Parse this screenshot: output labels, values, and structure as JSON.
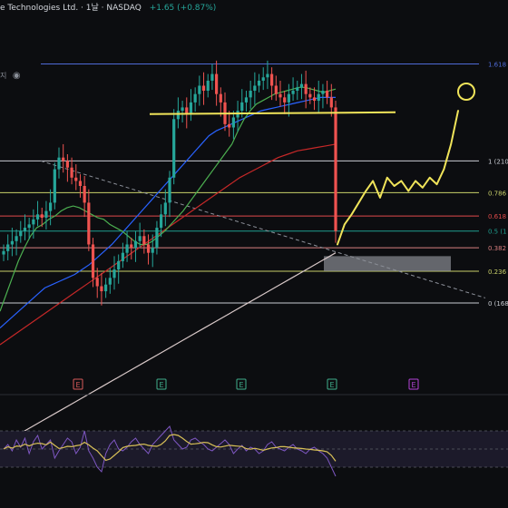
{
  "header": {
    "symbol_text": "e Technologies Ltd. · 1날 · NASDAQ",
    "change_text": "+1.65 (+0.87%)"
  },
  "indicator_label": "지",
  "chart_data": {
    "type": "line",
    "price_axis": {
      "min": 100,
      "max": 290
    },
    "bars_count": 79,
    "fib_levels": [
      {
        "label": "1.618",
        "value": 268,
        "color": "#4f6bd8"
      },
      {
        "label": "1 (210",
        "value": 210,
        "color": "#c9ccd2"
      },
      {
        "label": "0.786",
        "value": 191,
        "color": "#c9d06a"
      },
      {
        "label": "0.618",
        "value": 177,
        "color": "#e04a4a"
      },
      {
        "label": "0.5 (1",
        "value": 168,
        "color": "#1f9e8f"
      },
      {
        "label": "0.382",
        "value": 158,
        "color": "#d97f7f"
      },
      {
        "label": "0.236",
        "value": 144,
        "color": "#c9d06a"
      },
      {
        "label": "0 (168",
        "value": 125,
        "color": "#c9ccd2"
      }
    ],
    "candles_close": [
      156,
      160,
      162,
      165,
      168,
      170,
      172,
      175,
      178,
      176,
      180,
      185,
      205,
      212,
      210,
      206,
      200,
      198,
      195,
      185,
      160,
      140,
      135,
      132,
      136,
      140,
      145,
      150,
      155,
      160,
      158,
      162,
      165,
      160,
      155,
      158,
      170,
      178,
      185,
      200,
      235,
      240,
      242,
      238,
      245,
      250,
      255,
      252,
      258,
      262,
      250,
      245,
      232,
      230,
      236,
      240,
      245,
      248,
      252,
      255,
      258,
      260,
      262,
      255,
      250,
      248,
      245,
      250,
      252,
      254,
      256,
      250,
      248,
      246,
      250,
      252,
      248,
      242,
      168
    ],
    "ma_fast": [
      120,
      130,
      140,
      150,
      158,
      165,
      170,
      172,
      175,
      177,
      180,
      182,
      183,
      182,
      180,
      178,
      176,
      175,
      172,
      170,
      168,
      165,
      162,
      160,
      160,
      162,
      165,
      168,
      172,
      176,
      180,
      185,
      190,
      195,
      200,
      205,
      210,
      215,
      220,
      228,
      235,
      240,
      244,
      246,
      248,
      250,
      251,
      252,
      253,
      254,
      254,
      253,
      252,
      251,
      252,
      253
    ],
    "ma_mid": [
      110,
      114,
      118,
      122,
      126,
      130,
      134,
      136,
      138,
      140,
      142,
      145,
      148,
      152,
      156,
      160,
      165,
      170,
      175,
      180,
      185,
      190,
      195,
      200,
      205,
      210,
      215,
      220,
      225,
      228,
      230,
      232,
      234,
      236,
      238,
      240,
      241,
      242,
      243,
      244,
      245,
      246,
      247,
      248,
      248,
      248
    ],
    "ma_slow": [
      100,
      104,
      108,
      112,
      116,
      120,
      124,
      128,
      132,
      136,
      140,
      144,
      148,
      152,
      156,
      160,
      164,
      168,
      172,
      176,
      180,
      184,
      188,
      192,
      196,
      200,
      203,
      206,
      209,
      212,
      214,
      216,
      217,
      218,
      219,
      220
    ],
    "ma_200": [
      40,
      45,
      50,
      55,
      60,
      65,
      70,
      75,
      80,
      85,
      90,
      95,
      100,
      105,
      110,
      115,
      120,
      125,
      130,
      135,
      140,
      145,
      150,
      155
    ],
    "resistance_level": 238,
    "support_zone": [
      144,
      153
    ],
    "projection_path": [
      160,
      172,
      178,
      185,
      192,
      198,
      188,
      200,
      195,
      198,
      192,
      198,
      194,
      200,
      196,
      205,
      220,
      240
    ],
    "earnings_markers": [
      {
        "label": "E",
        "color": "#d95a5a"
      },
      {
        "label": "E",
        "color": "#3fae8c"
      },
      {
        "label": "E",
        "color": "#3fae8c"
      },
      {
        "label": "E",
        "color": "#3fae8c"
      },
      {
        "label": "E",
        "color": "#b444d8"
      }
    ],
    "rsi_range": [
      0,
      100
    ],
    "rsi_levels": [
      70,
      50,
      30
    ],
    "rsi_values": [
      50,
      55,
      48,
      60,
      52,
      62,
      45,
      58,
      65,
      50,
      55,
      60,
      40,
      48,
      55,
      62,
      58,
      45,
      52,
      70,
      48,
      40,
      30,
      25,
      45,
      55,
      60,
      50,
      48,
      52,
      58,
      62,
      55,
      50,
      45,
      55,
      60,
      65,
      70,
      75,
      60,
      55,
      50,
      52,
      60,
      62,
      58,
      55,
      50,
      48,
      52,
      56,
      60,
      55,
      45,
      50,
      54,
      48,
      52,
      50,
      45,
      48,
      55,
      58,
      52,
      50,
      48,
      52,
      55,
      50,
      48,
      45,
      50,
      52,
      48,
      45,
      40,
      30,
      20
    ],
    "colors": {
      "up": "#26a69a",
      "down": "#ef5350",
      "ma_fast": "#4caf50",
      "ma_mid": "#2962ff",
      "ma_slow": "#c62828",
      "ma_200": "#d8c8c8",
      "annotation": "#f0e45a",
      "rsi_line": "#7e57c2",
      "rsi_signal": "#d8c057",
      "rsi_band": "#1c1a2a"
    }
  }
}
